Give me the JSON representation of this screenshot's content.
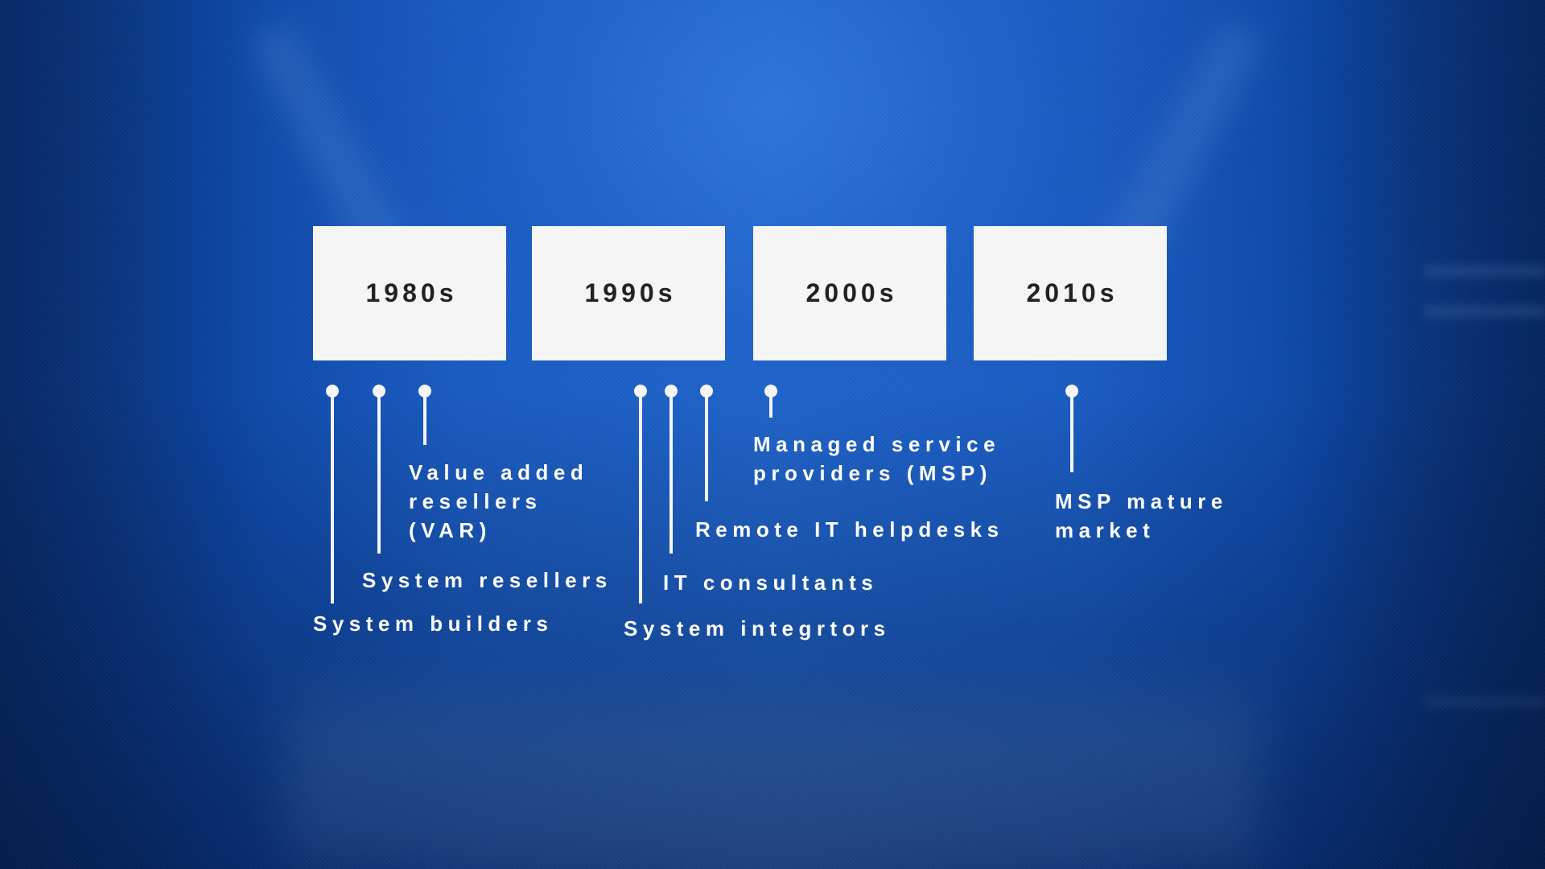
{
  "colors": {
    "background_primary": "#1b56b8",
    "box_fill": "#f5f5f5",
    "box_text": "#222222",
    "label_text": "#ffffff",
    "pin_color": "#f5f5f5"
  },
  "timeline": {
    "decades": [
      {
        "label": "1980s"
      },
      {
        "label": "1990s"
      },
      {
        "label": "2000s"
      },
      {
        "label": "2010s"
      }
    ],
    "events": [
      {
        "decade": "1980s",
        "lines": [
          "System builders"
        ]
      },
      {
        "decade": "1980s",
        "lines": [
          "System resellers"
        ]
      },
      {
        "decade": "1980s",
        "lines": [
          "Value added",
          "resellers",
          "(VAR)"
        ]
      },
      {
        "decade": "1990s",
        "lines": [
          "System integrtors"
        ]
      },
      {
        "decade": "1990s",
        "lines": [
          "IT consultants"
        ]
      },
      {
        "decade": "1990s",
        "lines": [
          "Remote IT helpdesks"
        ]
      },
      {
        "decade": "2000s",
        "lines": [
          "Managed service",
          "providers (MSP)"
        ]
      },
      {
        "decade": "2010s",
        "lines": [
          "MSP mature",
          "market"
        ]
      }
    ]
  }
}
